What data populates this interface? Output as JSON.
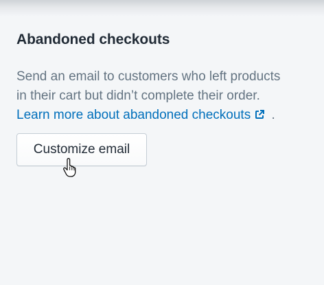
{
  "card": {
    "title": "Abandoned checkouts",
    "description_line1": "Send an email to customers who left products",
    "description_line2": "in their cart but didn’t complete their order.",
    "learn_more_link": "Learn more about abandoned checkouts",
    "trailing_period": ".",
    "external_link_icon": "external-link-icon"
  },
  "actions": {
    "customize_email_label": "Customize email"
  },
  "cursor": {
    "icon": "hand-pointer-icon"
  },
  "colors": {
    "background": "#f4f6f8",
    "title_text": "#212b36",
    "body_text": "#637381",
    "link": "#006fbb",
    "button_border": "#c4cdd5"
  }
}
